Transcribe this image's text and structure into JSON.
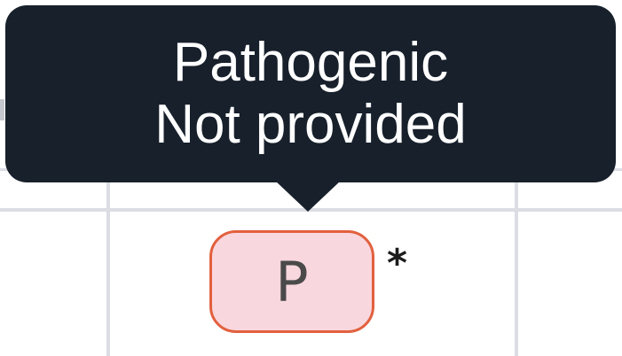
{
  "tooltip": {
    "line1": "Pathogenic",
    "line2": "Not provided",
    "background": "#17202b"
  },
  "badge": {
    "label": "P",
    "fill": "#f9d7de",
    "border": "#e2603e"
  },
  "asterisk": "*",
  "grid_color": "#dcdde4"
}
